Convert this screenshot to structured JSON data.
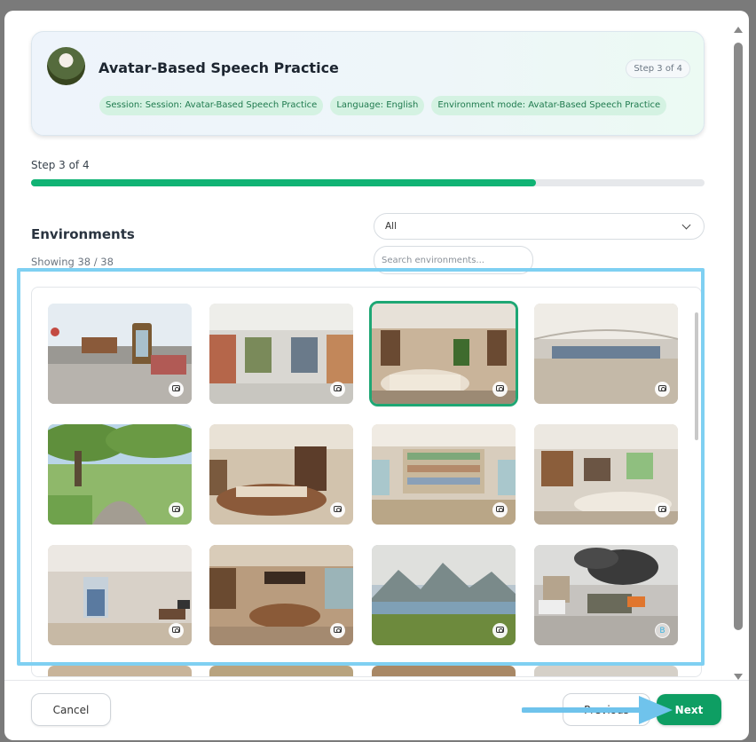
{
  "header": {
    "title": "Avatar-Based Speech Practice",
    "step_pill": "Step 3 of 4",
    "chips": [
      "Session: Session: Avatar-Based Speech Practice",
      "Language: English",
      "Environment mode: Avatar-Based Speech Practice"
    ]
  },
  "progress": {
    "label": "Step 3 of 4",
    "fraction": 0.75,
    "color": "#10b374"
  },
  "environments": {
    "title": "Environments",
    "count": "Showing 38 / 38",
    "filter_value": "All",
    "search_placeholder": "Search environments...",
    "tiles": [
      {
        "name": "street-bus-stop",
        "icon": "camera-icon",
        "selected": false
      },
      {
        "name": "grocery-aisle",
        "icon": "camera-icon",
        "selected": false
      },
      {
        "name": "office-reception",
        "icon": "camera-icon",
        "selected": true
      },
      {
        "name": "airport-terminal",
        "icon": "camera-icon",
        "selected": false
      },
      {
        "name": "park-path",
        "icon": "camera-icon",
        "selected": false
      },
      {
        "name": "living-room",
        "icon": "camera-icon",
        "selected": false
      },
      {
        "name": "pharmacy",
        "icon": "camera-icon",
        "selected": false
      },
      {
        "name": "kitchen",
        "icon": "camera-icon",
        "selected": false
      },
      {
        "name": "empty-room",
        "icon": "camera-icon",
        "selected": false
      },
      {
        "name": "cafe-counter",
        "icon": "camera-icon",
        "selected": false
      },
      {
        "name": "mountain-lake",
        "icon": "camera-icon",
        "selected": false
      },
      {
        "name": "burning-street",
        "icon": "letter",
        "badge_text": "B",
        "selected": false
      }
    ]
  },
  "footer": {
    "cancel_label": "Cancel",
    "previous_label": "Previous",
    "next_label": "Next"
  },
  "colors": {
    "accent": "#0e9e63",
    "highlight": "#7fd0f2"
  }
}
